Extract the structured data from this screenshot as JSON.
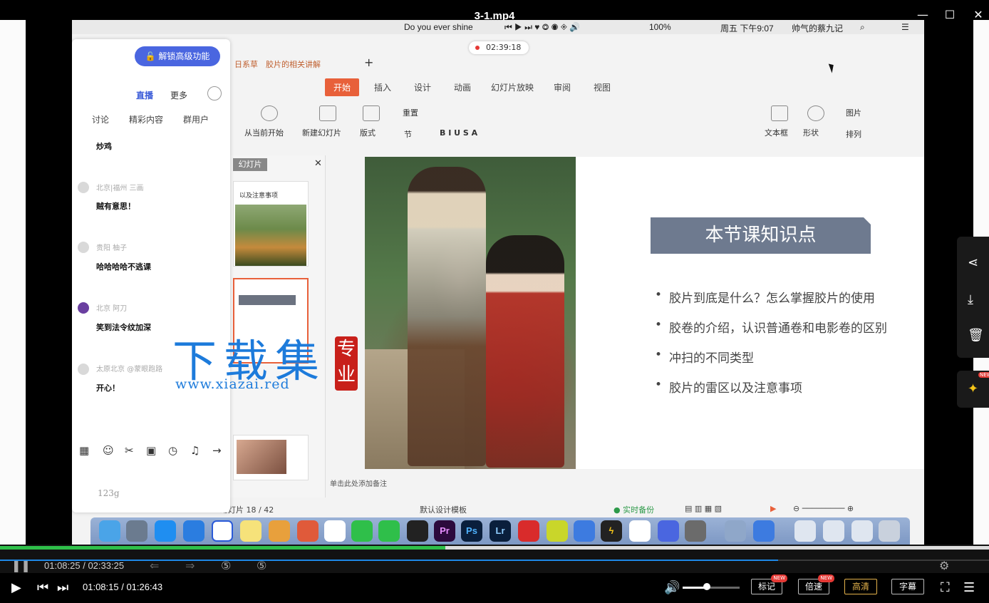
{
  "player": {
    "title": "3-1.mp4",
    "window_buttons": [
      "minimize",
      "maximize",
      "close"
    ],
    "current_time": "01:08:15",
    "total_time": "01:26:43",
    "progress_fraction": 0.787,
    "volume_fraction": 0.42,
    "buttons": {
      "mark": "标记",
      "speed": "倍速",
      "quality": "高清",
      "subtitle": "字幕",
      "new_badge": "NEW"
    }
  },
  "recording": {
    "inner_time": "01:08:25",
    "inner_total": "02:33:25",
    "inner_progress_fraction": 0.45,
    "rec_timer": "02:39:18"
  },
  "mac_menubar": {
    "song": "Do you ever shine",
    "battery": "100%",
    "datetime": "周五 下午9:07",
    "user": "帅气的蔡九记"
  },
  "ppt": {
    "file_tabs": [
      "日系草",
      "胶片的相关讲解"
    ],
    "ribbon_tabs": [
      "开始",
      "插入",
      "设计",
      "动画",
      "幻灯片放映",
      "审阅",
      "视图"
    ],
    "active_tab": "开始",
    "toolbar_labels": {
      "play_current": "从当前开始",
      "new_slide": "新建幻灯片",
      "layout": "版式",
      "reset": "重置",
      "section": "节",
      "textbox": "文本框",
      "shape": "形状",
      "picture": "图片",
      "arrange": "排列"
    },
    "slide_pane_title": "幻灯片",
    "thumb_caption": "以及注意事项",
    "notes_hint": "单击此处添加备注",
    "status_slide": "幻灯片 18 / 42",
    "status_template": "默认设计模板",
    "status_backup": "实时备份",
    "slide": {
      "title": "本节课知识点",
      "bullets": [
        "胶片到底是什么？怎么掌握胶片的使用",
        "胶卷的介绍，认识普通卷和电影卷的区别",
        "冲扫的不同类型",
        "胶片的雷区以及注意事项"
      ]
    }
  },
  "chat": {
    "unlock": "解锁高级功能",
    "top_tabs": {
      "live": "直播",
      "more": "更多"
    },
    "tabs": [
      "讨论",
      "精彩内容",
      "群用户"
    ],
    "messages": [
      {
        "name": "",
        "text": "炒鸡"
      },
      {
        "name": "北京|福州 三画",
        "text": "贼有意思！"
      },
      {
        "name": "贵阳 柚子",
        "text": "哈哈哈哈不逃课"
      },
      {
        "name": "北京 阿刀",
        "text": "笑到法令纹加深"
      },
      {
        "name": "太原北京 @蒙眼跑路",
        "text": "开心！"
      }
    ],
    "input_text": "123g"
  },
  "watermark": {
    "main": "下载集",
    "seal": "专业",
    "url": "www.xiazai.red"
  },
  "dock_apps": [
    "Pr",
    "Ps",
    "Lr"
  ],
  "colors": {
    "accent_orange": "#e8603a",
    "title_box": "#6e7a8f",
    "unlock_blue": "#4a66e0",
    "progress_green": "#2fbf4a",
    "progress_blue": "#1e88e5",
    "watermark_blue": "#1d7bdb",
    "quality_gold": "#e5b34b"
  }
}
